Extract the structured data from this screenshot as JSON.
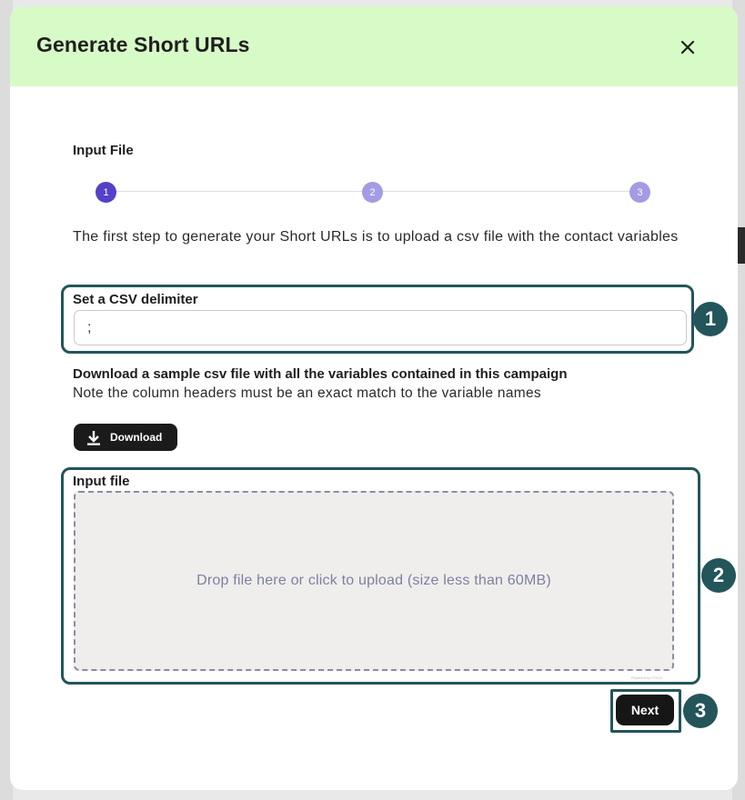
{
  "dialog": {
    "title": "Generate Short URLs",
    "close_icon": "close-icon"
  },
  "stepper": {
    "section_title": "Input File",
    "steps": [
      "1",
      "2",
      "3"
    ],
    "active_step": 1,
    "active_color": "#5540c8",
    "inactive_color": "#a39be3"
  },
  "intro": {
    "text": "The first step to generate your Short URLs is to upload a csv file with the contact variables"
  },
  "delimiter": {
    "label": "Set a CSV delimiter",
    "value": ";"
  },
  "sample": {
    "title": "Download a sample csv file with all the variables contained in this campaign",
    "note": "Note the column headers must be an exact match to the variable names",
    "download_label": "Download",
    "download_icon": "download-icon"
  },
  "upload": {
    "label": "Input file",
    "dropzone_text": "Drop file here or click to upload (size less than 60MB)",
    "powered_text": "Powered by FOCO"
  },
  "footer": {
    "next_label": "Next"
  },
  "annotations": {
    "badge_1": "1",
    "badge_2": "2",
    "badge_3": "3",
    "color": "#23555a"
  },
  "colors": {
    "header_bg": "#d7fbc6"
  }
}
